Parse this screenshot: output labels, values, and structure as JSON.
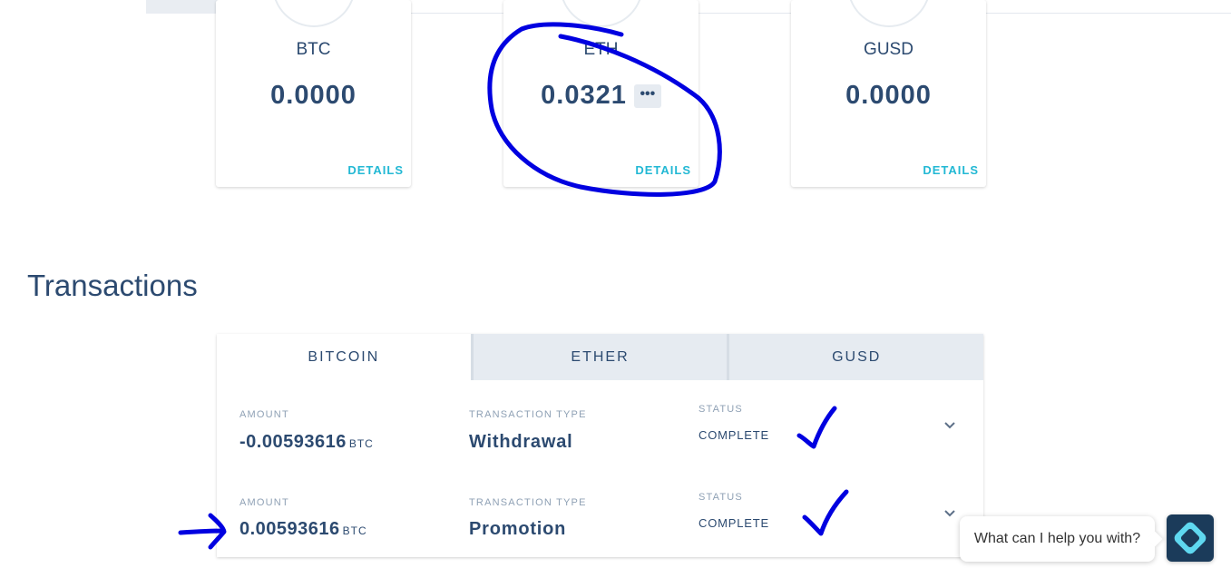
{
  "wallets": [
    {
      "ticker": "BTC",
      "balance": "0.0000",
      "details_label": "DETAILS"
    },
    {
      "ticker": "ETH",
      "balance": "0.0321",
      "details_label": "DETAILS",
      "more_label": "•••"
    },
    {
      "ticker": "GUSD",
      "balance": "0.0000",
      "details_label": "DETAILS"
    }
  ],
  "transactions": {
    "title": "Transactions",
    "tabs": [
      {
        "label": "BITCOIN",
        "active": true
      },
      {
        "label": "ETHER",
        "active": false
      },
      {
        "label": "GUSD",
        "active": false
      }
    ],
    "column_labels": {
      "amount": "AMOUNT",
      "type": "TRANSACTION TYPE",
      "status": "STATUS"
    },
    "rows": [
      {
        "amount": "-0.00593616",
        "unit": "BTC",
        "type": "Withdrawal",
        "status": "COMPLETE"
      },
      {
        "amount": "0.00593616",
        "unit": "BTC",
        "type": "Promotion",
        "status": "COMPLETE"
      }
    ]
  },
  "chat": {
    "prompt": "What can I help you with?"
  },
  "icons": {
    "more": "more-horizontal-icon",
    "expand": "chevron-down-icon",
    "chat": "chat-launcher-icon"
  },
  "colors": {
    "text_primary": "#2c4a70",
    "link": "#22b8d4",
    "tab_inactive": "#e6ebf1",
    "label_muted": "#8fa1b5",
    "annotation_ink": "#0000e0",
    "chat_launcher": "#1b3b5a"
  }
}
